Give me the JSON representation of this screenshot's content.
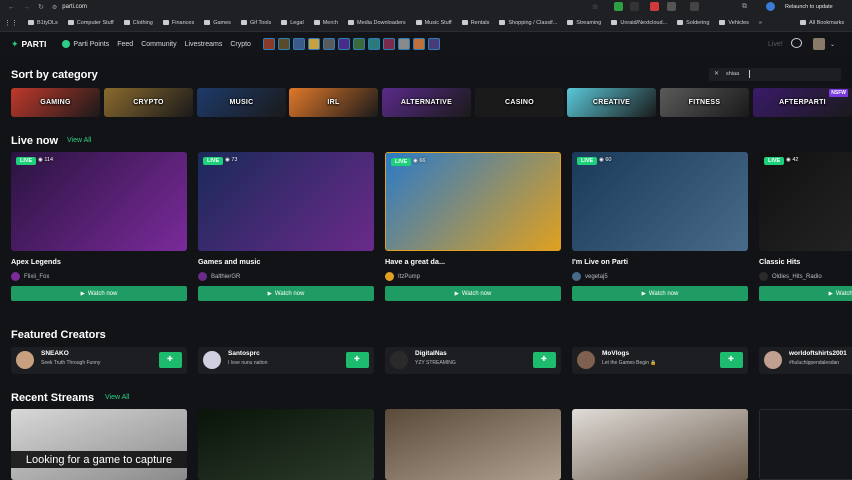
{
  "browser": {
    "url": "parti.com",
    "relaunch_label": "Relaunch to update",
    "bookmarks": [
      "B1tyDLs",
      "Computer Stuff",
      "Clothing",
      "Finances",
      "Games",
      "Gif Tools",
      "Legal",
      "Merch",
      "Media Downloaders",
      "Music Stuff",
      "Rentals",
      "Shopping / Classif...",
      "Streaming",
      "Unraid/Nextcloud...",
      "Soldering",
      "Vehicles"
    ],
    "all_bookmarks": "All Bookmarks"
  },
  "nav": {
    "logo": "PARTI",
    "links": [
      "Parti Points",
      "Feed",
      "Community",
      "Livestreams",
      "Crypto"
    ],
    "live_label": "Live!",
    "community_icon_count": 12
  },
  "search": {
    "value": "shiaa",
    "icon": "close-icon"
  },
  "sort": {
    "title": "Sort by category",
    "categories": [
      {
        "label": "GAMING",
        "color": "#c0392b"
      },
      {
        "label": "CRYPTO",
        "color": "#8a6a2e"
      },
      {
        "label": "MUSIC",
        "color": "#1e3a6a"
      },
      {
        "label": "IRL",
        "color": "#e0782a"
      },
      {
        "label": "ALTERNATIVE",
        "color": "#5a2a8a"
      },
      {
        "label": "CASINO",
        "color": "#1a1a1a"
      },
      {
        "label": "CREATIVE",
        "color": "#5ac8d8"
      },
      {
        "label": "FITNESS",
        "color": "#5a5a5a"
      },
      {
        "label": "AFTERPARTI",
        "color": "#3a1a6a",
        "badge": "NSFW"
      }
    ]
  },
  "live_now": {
    "title": "Live now",
    "view_all": "View All",
    "live_badge": "LIVE",
    "watch_label": "Watch now",
    "streams": [
      {
        "title": "Apex Legends",
        "user": "Flixii_Fox",
        "viewers": "114",
        "colors": [
          "#2a1440",
          "#7a2a9a"
        ]
      },
      {
        "title": "Games and music",
        "user": "BalthierGR",
        "viewers": "73",
        "colors": [
          "#1a2a5a",
          "#6a2a8a"
        ]
      },
      {
        "title": "Have a great da...",
        "user": "ItzPump",
        "viewers": "66",
        "colors": [
          "#2a7ac8",
          "#e0a020"
        ]
      },
      {
        "title": "I'm Live on Parti",
        "user": "vegetaj5",
        "viewers": "60",
        "colors": [
          "#1a3a5a",
          "#4a6a8a"
        ]
      },
      {
        "title": "Classic Hits",
        "user": "Oldies_Hits_Radio",
        "viewers": "42",
        "colors": [
          "#111111",
          "#2a2a2a"
        ]
      }
    ]
  },
  "featured": {
    "title": "Featured Creators",
    "creators": [
      {
        "name": "SNEAKO",
        "bio": "Seek Truth Through Funny",
        "color": "#c8a080"
      },
      {
        "name": "Santosprc",
        "bio": "I love nunu nation",
        "color": "#d0d0e0"
      },
      {
        "name": "DigitalNas",
        "bio": "YZY STREAMING",
        "color": "#2a2a2a"
      },
      {
        "name": "MoVlogs",
        "bio": "Let the Games Begin 🔒",
        "color": "#806050"
      },
      {
        "name": "worldoftshirts2001",
        "bio": "#huluchippendalesdan",
        "color": "#c0a090"
      }
    ]
  },
  "recent": {
    "title": "Recent Streams",
    "view_all": "View All",
    "caption": "Looking for a game to capture",
    "streams": [
      {
        "colors": [
          "#d8d8d8",
          "#8a8a8a"
        ]
      },
      {
        "colors": [
          "#0a140a",
          "#2a3a2a"
        ]
      },
      {
        "colors": [
          "#5a4a3a",
          "#b0a090"
        ]
      },
      {
        "colors": [
          "#e0dcd8",
          "#6a5a4a"
        ]
      },
      {
        "colors": [
          "#15161a",
          "#15161a"
        ]
      }
    ]
  }
}
